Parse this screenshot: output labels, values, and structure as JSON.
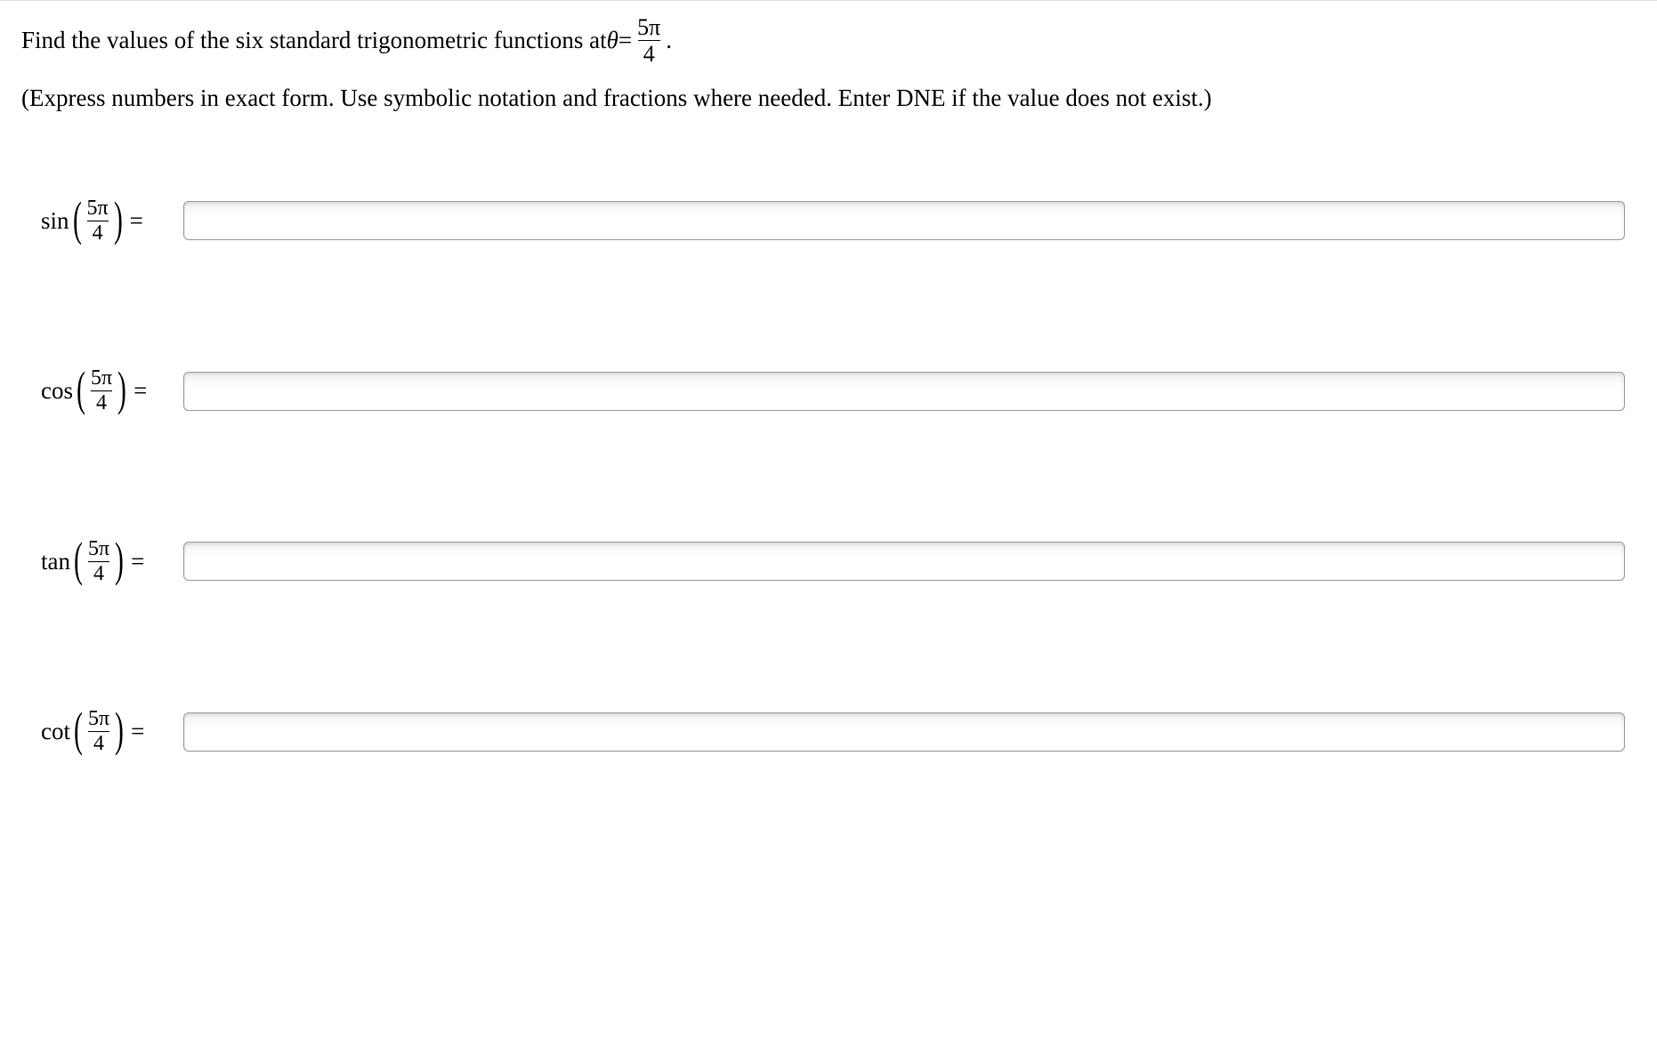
{
  "question": {
    "prefix": "Find the values of the six standard trigonometric functions at ",
    "theta": "θ",
    "equals": " = ",
    "theta_value": {
      "num": "5π",
      "den": "4"
    },
    "suffix": "."
  },
  "instruction": "(Express numbers in exact form. Use symbolic notation and fractions where needed. Enter DNE if the value does not exist.)",
  "rows": [
    {
      "fn": "sin",
      "arg": {
        "num": "5π",
        "den": "4"
      },
      "value": ""
    },
    {
      "fn": "cos",
      "arg": {
        "num": "5π",
        "den": "4"
      },
      "value": ""
    },
    {
      "fn": "tan",
      "arg": {
        "num": "5π",
        "den": "4"
      },
      "value": ""
    },
    {
      "fn": "cot",
      "arg": {
        "num": "5π",
        "den": "4"
      },
      "value": ""
    }
  ],
  "symbols": {
    "equals": "="
  }
}
